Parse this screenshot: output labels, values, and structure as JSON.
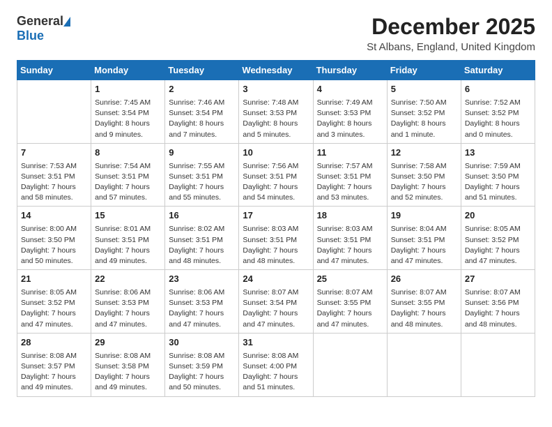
{
  "logo": {
    "general": "General",
    "blue": "Blue"
  },
  "title": "December 2025",
  "location": "St Albans, England, United Kingdom",
  "days_of_week": [
    "Sunday",
    "Monday",
    "Tuesday",
    "Wednesday",
    "Thursday",
    "Friday",
    "Saturday"
  ],
  "weeks": [
    [
      {
        "day": "",
        "info": ""
      },
      {
        "day": "1",
        "info": "Sunrise: 7:45 AM\nSunset: 3:54 PM\nDaylight: 8 hours\nand 9 minutes."
      },
      {
        "day": "2",
        "info": "Sunrise: 7:46 AM\nSunset: 3:54 PM\nDaylight: 8 hours\nand 7 minutes."
      },
      {
        "day": "3",
        "info": "Sunrise: 7:48 AM\nSunset: 3:53 PM\nDaylight: 8 hours\nand 5 minutes."
      },
      {
        "day": "4",
        "info": "Sunrise: 7:49 AM\nSunset: 3:53 PM\nDaylight: 8 hours\nand 3 minutes."
      },
      {
        "day": "5",
        "info": "Sunrise: 7:50 AM\nSunset: 3:52 PM\nDaylight: 8 hours\nand 1 minute."
      },
      {
        "day": "6",
        "info": "Sunrise: 7:52 AM\nSunset: 3:52 PM\nDaylight: 8 hours\nand 0 minutes."
      }
    ],
    [
      {
        "day": "7",
        "info": "Sunrise: 7:53 AM\nSunset: 3:51 PM\nDaylight: 7 hours\nand 58 minutes."
      },
      {
        "day": "8",
        "info": "Sunrise: 7:54 AM\nSunset: 3:51 PM\nDaylight: 7 hours\nand 57 minutes."
      },
      {
        "day": "9",
        "info": "Sunrise: 7:55 AM\nSunset: 3:51 PM\nDaylight: 7 hours\nand 55 minutes."
      },
      {
        "day": "10",
        "info": "Sunrise: 7:56 AM\nSunset: 3:51 PM\nDaylight: 7 hours\nand 54 minutes."
      },
      {
        "day": "11",
        "info": "Sunrise: 7:57 AM\nSunset: 3:51 PM\nDaylight: 7 hours\nand 53 minutes."
      },
      {
        "day": "12",
        "info": "Sunrise: 7:58 AM\nSunset: 3:50 PM\nDaylight: 7 hours\nand 52 minutes."
      },
      {
        "day": "13",
        "info": "Sunrise: 7:59 AM\nSunset: 3:50 PM\nDaylight: 7 hours\nand 51 minutes."
      }
    ],
    [
      {
        "day": "14",
        "info": "Sunrise: 8:00 AM\nSunset: 3:50 PM\nDaylight: 7 hours\nand 50 minutes."
      },
      {
        "day": "15",
        "info": "Sunrise: 8:01 AM\nSunset: 3:51 PM\nDaylight: 7 hours\nand 49 minutes."
      },
      {
        "day": "16",
        "info": "Sunrise: 8:02 AM\nSunset: 3:51 PM\nDaylight: 7 hours\nand 48 minutes."
      },
      {
        "day": "17",
        "info": "Sunrise: 8:03 AM\nSunset: 3:51 PM\nDaylight: 7 hours\nand 48 minutes."
      },
      {
        "day": "18",
        "info": "Sunrise: 8:03 AM\nSunset: 3:51 PM\nDaylight: 7 hours\nand 47 minutes."
      },
      {
        "day": "19",
        "info": "Sunrise: 8:04 AM\nSunset: 3:51 PM\nDaylight: 7 hours\nand 47 minutes."
      },
      {
        "day": "20",
        "info": "Sunrise: 8:05 AM\nSunset: 3:52 PM\nDaylight: 7 hours\nand 47 minutes."
      }
    ],
    [
      {
        "day": "21",
        "info": "Sunrise: 8:05 AM\nSunset: 3:52 PM\nDaylight: 7 hours\nand 47 minutes."
      },
      {
        "day": "22",
        "info": "Sunrise: 8:06 AM\nSunset: 3:53 PM\nDaylight: 7 hours\nand 47 minutes."
      },
      {
        "day": "23",
        "info": "Sunrise: 8:06 AM\nSunset: 3:53 PM\nDaylight: 7 hours\nand 47 minutes."
      },
      {
        "day": "24",
        "info": "Sunrise: 8:07 AM\nSunset: 3:54 PM\nDaylight: 7 hours\nand 47 minutes."
      },
      {
        "day": "25",
        "info": "Sunrise: 8:07 AM\nSunset: 3:55 PM\nDaylight: 7 hours\nand 47 minutes."
      },
      {
        "day": "26",
        "info": "Sunrise: 8:07 AM\nSunset: 3:55 PM\nDaylight: 7 hours\nand 48 minutes."
      },
      {
        "day": "27",
        "info": "Sunrise: 8:07 AM\nSunset: 3:56 PM\nDaylight: 7 hours\nand 48 minutes."
      }
    ],
    [
      {
        "day": "28",
        "info": "Sunrise: 8:08 AM\nSunset: 3:57 PM\nDaylight: 7 hours\nand 49 minutes."
      },
      {
        "day": "29",
        "info": "Sunrise: 8:08 AM\nSunset: 3:58 PM\nDaylight: 7 hours\nand 49 minutes."
      },
      {
        "day": "30",
        "info": "Sunrise: 8:08 AM\nSunset: 3:59 PM\nDaylight: 7 hours\nand 50 minutes."
      },
      {
        "day": "31",
        "info": "Sunrise: 8:08 AM\nSunset: 4:00 PM\nDaylight: 7 hours\nand 51 minutes."
      },
      {
        "day": "",
        "info": ""
      },
      {
        "day": "",
        "info": ""
      },
      {
        "day": "",
        "info": ""
      }
    ]
  ]
}
